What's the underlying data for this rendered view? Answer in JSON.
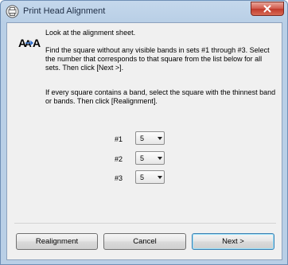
{
  "window": {
    "title": "Print Head Alignment"
  },
  "instructions": {
    "line1": "Look at the alignment sheet.",
    "line2": "Find the square without any visible bands in sets #1 through #3. Select the number that corresponds to that square from the list below for all sets. Then click [Next >].",
    "line3": "If every square contains a band, select the square with the thinnest band or bands. Then click [Realignment]."
  },
  "sets": [
    {
      "label": "#1",
      "value": "5"
    },
    {
      "label": "#2",
      "value": "5"
    },
    {
      "label": "#3",
      "value": "5"
    }
  ],
  "buttons": {
    "realignment": "Realignment",
    "cancel": "Cancel",
    "next": "Next >"
  },
  "icons": {
    "app": "printer-icon",
    "alignment": "alignment-aa-icon",
    "close": "close-icon",
    "dropdown": "chevron-down-icon"
  },
  "colors": {
    "title_bar": "#b9cfe6",
    "close_button": "#c03a2b",
    "client_bg": "#f0f0f0",
    "default_button_border": "#3c7fb1"
  }
}
